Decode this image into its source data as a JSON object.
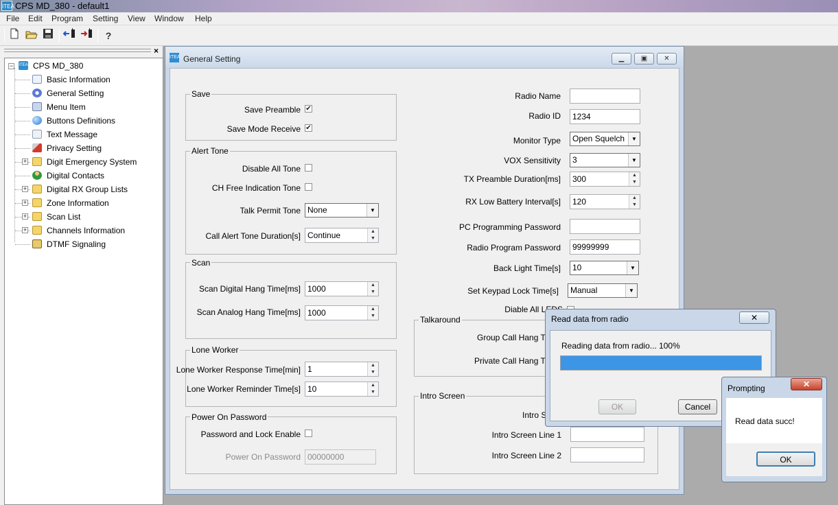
{
  "app": {
    "title": "CPS MD_380 - default1",
    "icon_text": "ITEA"
  },
  "menu": [
    "File",
    "Edit",
    "Program",
    "Setting",
    "View",
    "Window",
    "Help"
  ],
  "toolbar": {
    "icons": [
      "new-file-icon",
      "open-folder-icon",
      "save-icon",
      "read-radio-icon",
      "write-radio-icon",
      "help-icon"
    ],
    "help_glyph": "?"
  },
  "tree": {
    "close_glyph": "×",
    "root": "CPS MD_380",
    "items": [
      {
        "label": "Basic Information",
        "icon": "document-icon",
        "expandable": false
      },
      {
        "label": "General Setting",
        "icon": "gear-icon",
        "expandable": false
      },
      {
        "label": "Menu Item",
        "icon": "menu-edit-icon",
        "expandable": false
      },
      {
        "label": "Buttons Definitions",
        "icon": "globe-icon",
        "expandable": false
      },
      {
        "label": "Text Message",
        "icon": "message-check-icon",
        "expandable": false
      },
      {
        "label": "Privacy Setting",
        "icon": "key-icon",
        "expandable": false
      },
      {
        "label": "Digit Emergency System",
        "icon": "folder-icon",
        "expandable": true
      },
      {
        "label": "Digital Contacts",
        "icon": "contact-person-icon",
        "expandable": false
      },
      {
        "label": "Digital RX Group Lists",
        "icon": "folder-icon",
        "expandable": true
      },
      {
        "label": "Zone Information",
        "icon": "folder-icon",
        "expandable": true
      },
      {
        "label": "Scan List",
        "icon": "folder-icon",
        "expandable": true
      },
      {
        "label": "Channels Information",
        "icon": "folder-icon",
        "expandable": true
      },
      {
        "label": "DTMF Signaling",
        "icon": "dtmf-icon",
        "expandable": false
      }
    ]
  },
  "general_setting": {
    "title": "General Setting",
    "save": {
      "group": "Save",
      "save_preamble": "Save Preamble",
      "save_preamble_checked": true,
      "save_mode_receive": "Save Mode Receive",
      "save_mode_receive_checked": true
    },
    "alert_tone": {
      "group": "Alert Tone",
      "disable_all_tone": "Disable All Tone",
      "ch_free_indication_tone": "CH Free Indication Tone",
      "talk_permit_tone": "Talk Permit Tone",
      "talk_permit_tone_value": "None",
      "call_alert_tone_duration": "Call Alert Tone Duration[s]",
      "call_alert_tone_duration_value": "Continue"
    },
    "scan": {
      "group": "Scan",
      "digital_hang": "Scan Digital Hang Time[ms]",
      "digital_hang_value": "1000",
      "analog_hang": "Scan Analog Hang Time[ms]",
      "analog_hang_value": "1000"
    },
    "lone_worker": {
      "group": "Lone Worker",
      "response": "Lone Worker Response Time[min]",
      "response_value": "1",
      "reminder": "Lone Worker Reminder Time[s]",
      "reminder_value": "10"
    },
    "power_on_password": {
      "group": "Power On Password",
      "password_lock_enable": "Password and Lock Enable",
      "power_on_password": "Power On Password",
      "power_on_password_value": "00000000"
    },
    "right": {
      "radio_name": "Radio Name",
      "radio_name_value": "",
      "radio_id": "Radio ID",
      "radio_id_value": "1234",
      "monitor_type": "Monitor Type",
      "monitor_type_value": "Open Squelch",
      "vox_sensitivity": "VOX Sensitivity",
      "vox_sensitivity_value": "3",
      "tx_preamble": "TX Preamble Duration[ms]",
      "tx_preamble_value": "300",
      "rx_low_battery": "RX Low Battery Interval[s]",
      "rx_low_battery_value": "120",
      "pc_prog_password": "PC Programming Password",
      "pc_prog_password_value": "",
      "radio_prog_password": "Radio Program Password",
      "radio_prog_password_value": "99999999",
      "back_light_time": "Back Light Time[s]",
      "back_light_time_value": "10",
      "keypad_lock_time": "Set Keypad Lock Time[s]",
      "keypad_lock_time_value": "Manual",
      "disable_all_leds": "Diable All LEDS"
    },
    "talkaround": {
      "group": "Talkaround",
      "group_call_hang": "Group Call Hang Time",
      "private_call_hang": "Private Call Hang Time"
    },
    "intro_screen": {
      "group": "Intro Screen",
      "intro_screen": "Intro Sc",
      "line1": "Intro Screen Line 1",
      "line1_value": "",
      "line2": "Intro Screen Line 2",
      "line2_value": ""
    }
  },
  "read_dialog": {
    "title": "Read data from radio",
    "close_glyph": "✕",
    "status": "Reading data from radio... 100%",
    "progress": 1.0,
    "ok": "OK",
    "cancel": "Cancel"
  },
  "prompt_dialog": {
    "title": "Prompting",
    "close_glyph": "✕",
    "message": "Read data succ!",
    "ok": "OK"
  },
  "colors": {
    "progress_fill": "#3d95e6",
    "title_gradient": "#b3a3c7"
  }
}
